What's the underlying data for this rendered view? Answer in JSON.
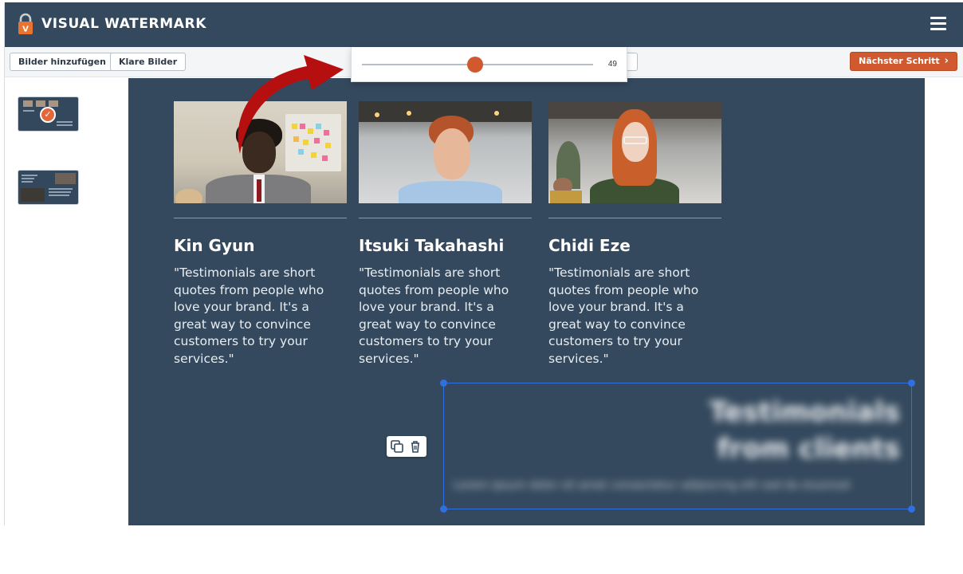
{
  "app": {
    "title": "VISUAL WATERMARK"
  },
  "toolbar": {
    "add_images_label": "Bilder hinzufügen",
    "clear_images_label": "Klare Bilder",
    "next_step_label": "Nächster Schritt"
  },
  "slider": {
    "value": 49,
    "max": 100,
    "value_label": "49"
  },
  "canvas": {
    "cards": [
      {
        "name": "Kin Gyun",
        "quote": "\"Testimonials are short quotes from people who love your brand. It's a great way to convince customers to try your services.\""
      },
      {
        "name": "Itsuki Takahashi",
        "quote": "\"Testimonials are short quotes from people who love your brand. It's a great way to convince customers to try your services.\""
      },
      {
        "name": "Chidi Eze",
        "quote": "\"Testimonials are short quotes from people who love your brand. It's a great way to convince customers to try your services.\""
      }
    ]
  },
  "colors": {
    "header_bg": "#34495e",
    "accent_orange": "#d0592f",
    "selection_blue": "#2f6fe0",
    "arrow_red": "#b50f0f"
  },
  "icons": {
    "logo": "padlock-icon",
    "menu": "hamburger-menu-icon",
    "next": "chevron-right-icon",
    "duplicate": "duplicate-icon",
    "delete": "trash-icon",
    "selected": "check-icon"
  }
}
